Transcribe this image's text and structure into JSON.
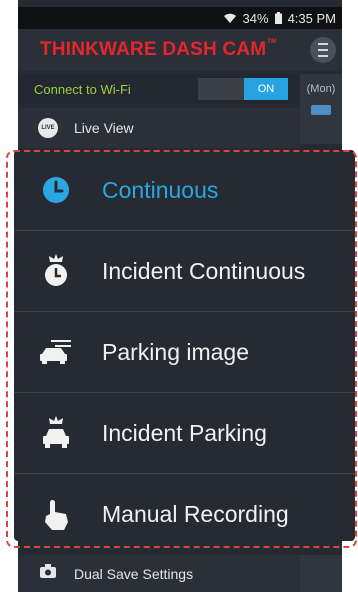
{
  "status_bar": {
    "battery": "34%",
    "time": "4:35 PM"
  },
  "app_header": {
    "title": "THINKWARE DASH CAM",
    "trademark": "TM"
  },
  "wifi": {
    "label": "Connect to Wi-Fi",
    "toggle": "ON"
  },
  "side_panel": {
    "day_label": "(Mon)"
  },
  "live_view": {
    "label": "Live View",
    "badge": "LIVE"
  },
  "recording_menu": {
    "items": [
      {
        "label": "Continuous",
        "icon": "clock-icon",
        "selected": true
      },
      {
        "label": "Incident Continuous",
        "icon": "incident-clock-icon"
      },
      {
        "label": "Parking image",
        "icon": "parking-car-icon"
      },
      {
        "label": "Incident Parking",
        "icon": "incident-car-icon"
      },
      {
        "label": "Manual Recording",
        "icon": "hand-pointer-icon"
      }
    ]
  },
  "dual_save": {
    "label": "Dual Save Settings",
    "icon": "camera-save-icon"
  },
  "colors": {
    "accent": "#2ba6e0",
    "brand": "#e5262b",
    "wifi_label": "#9bd13c",
    "highlight_frame": "#d9463a"
  }
}
